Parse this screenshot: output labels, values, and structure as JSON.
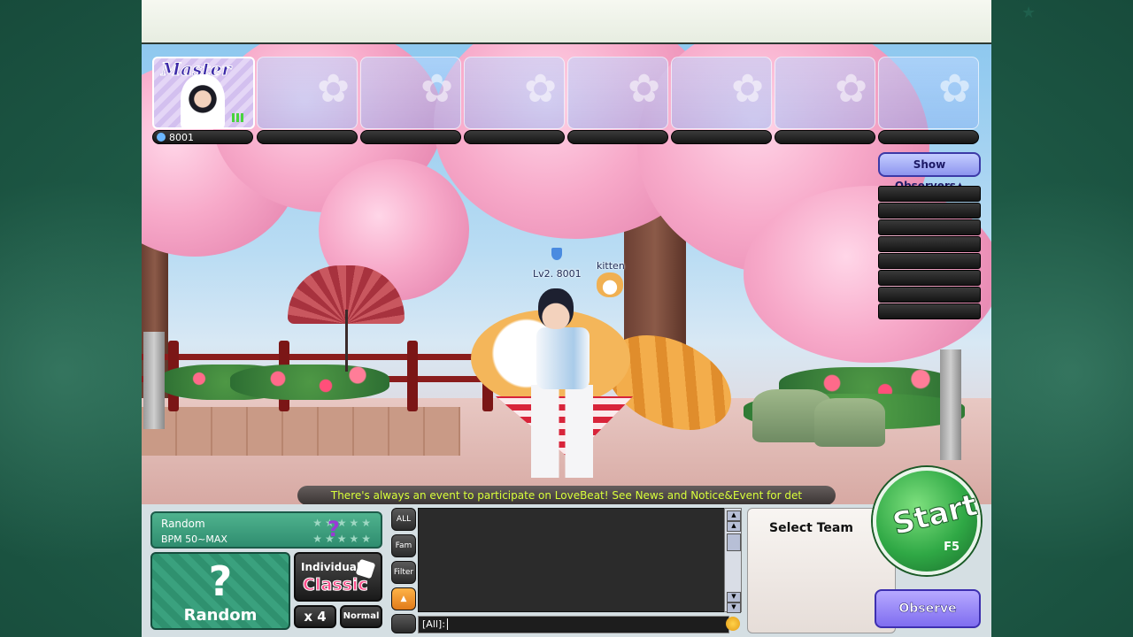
{
  "master": {
    "title": "Master",
    "player_id": "8001"
  },
  "observers": {
    "label": "Show Observers▲"
  },
  "avatar": {
    "level_name": "Lv2. 8001",
    "pet_name": "kitten"
  },
  "ticker": {
    "text": "There's always an event to participate on LoveBeat! See News and Notice&Event for det"
  },
  "song": {
    "title": "Random",
    "bpm": "BPM 50~MAX",
    "qmark": "?",
    "stars_top": "★★★★★",
    "stars_bottom": "★★★★★"
  },
  "random_button": {
    "icon": "?",
    "label": "Random"
  },
  "mode": {
    "line1": "Individual",
    "line2": "Classic"
  },
  "speed": {
    "label": "x 4"
  },
  "difficulty": {
    "label": "Normal"
  },
  "chat": {
    "tabs": [
      "ALL",
      "Fam",
      "Filter"
    ],
    "input_prefix": "[All]:",
    "scroll_up": "▲",
    "scroll_down": "▼"
  },
  "team": {
    "label": "Select Team"
  },
  "start": {
    "label": "Start",
    "hotkey": "F5"
  },
  "observe": {
    "label": "Observe"
  },
  "colors": {
    "ticker_text": "#d9ff3a",
    "start_green": "#2fa845",
    "observe_purple": "#7f6df0",
    "song_teal": "#2f8d6f"
  }
}
